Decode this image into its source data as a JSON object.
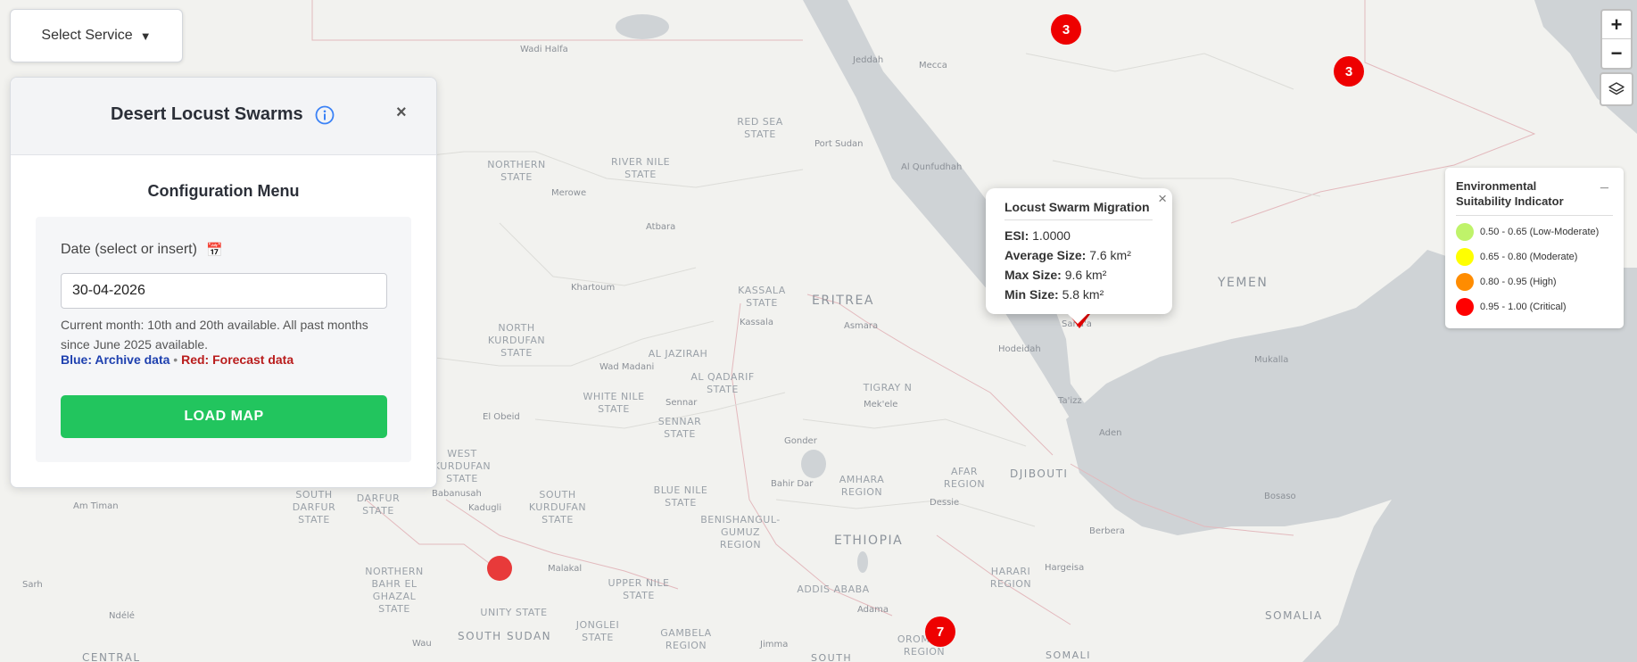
{
  "service_select": {
    "label": "Select Service",
    "arrow": "▼"
  },
  "panel": {
    "title": "Desert Locust Swarms",
    "info_icon": "info-icon",
    "close": "×",
    "config_title": "Configuration Menu",
    "date_label": "Date (select or insert)",
    "calendar_icon": "📅",
    "date_value": "30-04-2026",
    "hint": "Current month: 10th and 20th available. All past months since June 2025 available.",
    "archive_label": "Blue: Archive data",
    "separator": "•",
    "forecast_label": "Red: Forecast data",
    "load_button": "LOAD MAP",
    "colors": {
      "load_button": "#22c55e",
      "archive": "#1e40af",
      "forecast": "#b91c1c"
    }
  },
  "map_controls": {
    "zoom_in": "+",
    "zoom_out": "−",
    "layers_icon": "layers-icon"
  },
  "popup": {
    "title": "Locust Swarm Migration",
    "close": "×",
    "rows": [
      {
        "label": "ESI:",
        "value": "1.0000"
      },
      {
        "label": "Average Size:",
        "value": "7.6 km²"
      },
      {
        "label": "Max Size:",
        "value": "9.6 km²"
      },
      {
        "label": "Min Size:",
        "value": "5.8 km²"
      }
    ]
  },
  "esi_legend": {
    "title": "Environmental Suitability Indicator",
    "minimize": "_",
    "items": [
      {
        "label": "0.50 - 0.65 (Low-Moderate)",
        "color": "#bff36a"
      },
      {
        "label": "0.65 - 0.80 (Moderate)",
        "color": "#ffff00"
      },
      {
        "label": "0.80 - 0.95 (High)",
        "color": "#ff8c00"
      },
      {
        "label": "0.95 - 1.00 (Critical)",
        "color": "#ff0000"
      }
    ]
  },
  "markers": [
    {
      "label": "3",
      "color": "#ee0000"
    },
    {
      "label": "3",
      "color": "#ee0000"
    },
    {
      "label": "7",
      "color": "#ee0000"
    },
    {
      "label": "",
      "color": "#e83a3a"
    }
  ],
  "map_labels": {
    "countries": [
      "ERITREA",
      "YEMEN",
      "ETHIOPIA",
      "DJIBOUTI",
      "SOMALIA",
      "SOUTH SUDAN",
      "CENTRAL",
      "SOUTH",
      "SOMALI"
    ],
    "regions": [
      "NORTHERN STATE",
      "RIVER NILE STATE",
      "RED SEA STATE",
      "KASSALA STATE",
      "NORTH KURDUFAN STATE",
      "AL JAZIRAH",
      "AL QADARIF STATE",
      "WHITE NILE STATE",
      "SENNAR STATE",
      "TIGRAY N",
      "WEST KURDUFAN STATE",
      "SOUTH DARFUR STATE",
      "EAST DARFUR STATE",
      "SOUTH KURDUFAN STATE",
      "BLUE NILE STATE",
      "BENISHANGUL-GUMUZ REGION",
      "AMHARA REGION",
      "AFAR REGION",
      "HARARI REGION",
      "NORTHERN BAHR EL GHAZAL STATE",
      "UNITY STATE",
      "UPPER NILE STATE",
      "JONGLEI STATE",
      "GAMBELA REGION",
      "ADDIS ABABA",
      "OROMIA REGION"
    ],
    "cities": [
      "Wadi Halfa",
      "Jeddah",
      "Mecca",
      "Port Sudan",
      "Al Qunfudhah",
      "Merowe",
      "Atbara",
      "Khartoum",
      "Kassala",
      "Asmara",
      "Hodeidah",
      "Mukalla",
      "Wad Madani",
      "Sennar",
      "Mek'ele",
      "Ta'izz",
      "Aden",
      "El Obeid",
      "Gonder",
      "Bahir Dar",
      "Dessie",
      "Babanusah",
      "Kadugli",
      "Am Timan",
      "Bosaso",
      "Berbera",
      "Hargeisa",
      "Malakal",
      "Adama",
      "Jimma",
      "Sarh",
      "Ndélé",
      "Wau",
      "Sana'a"
    ]
  }
}
